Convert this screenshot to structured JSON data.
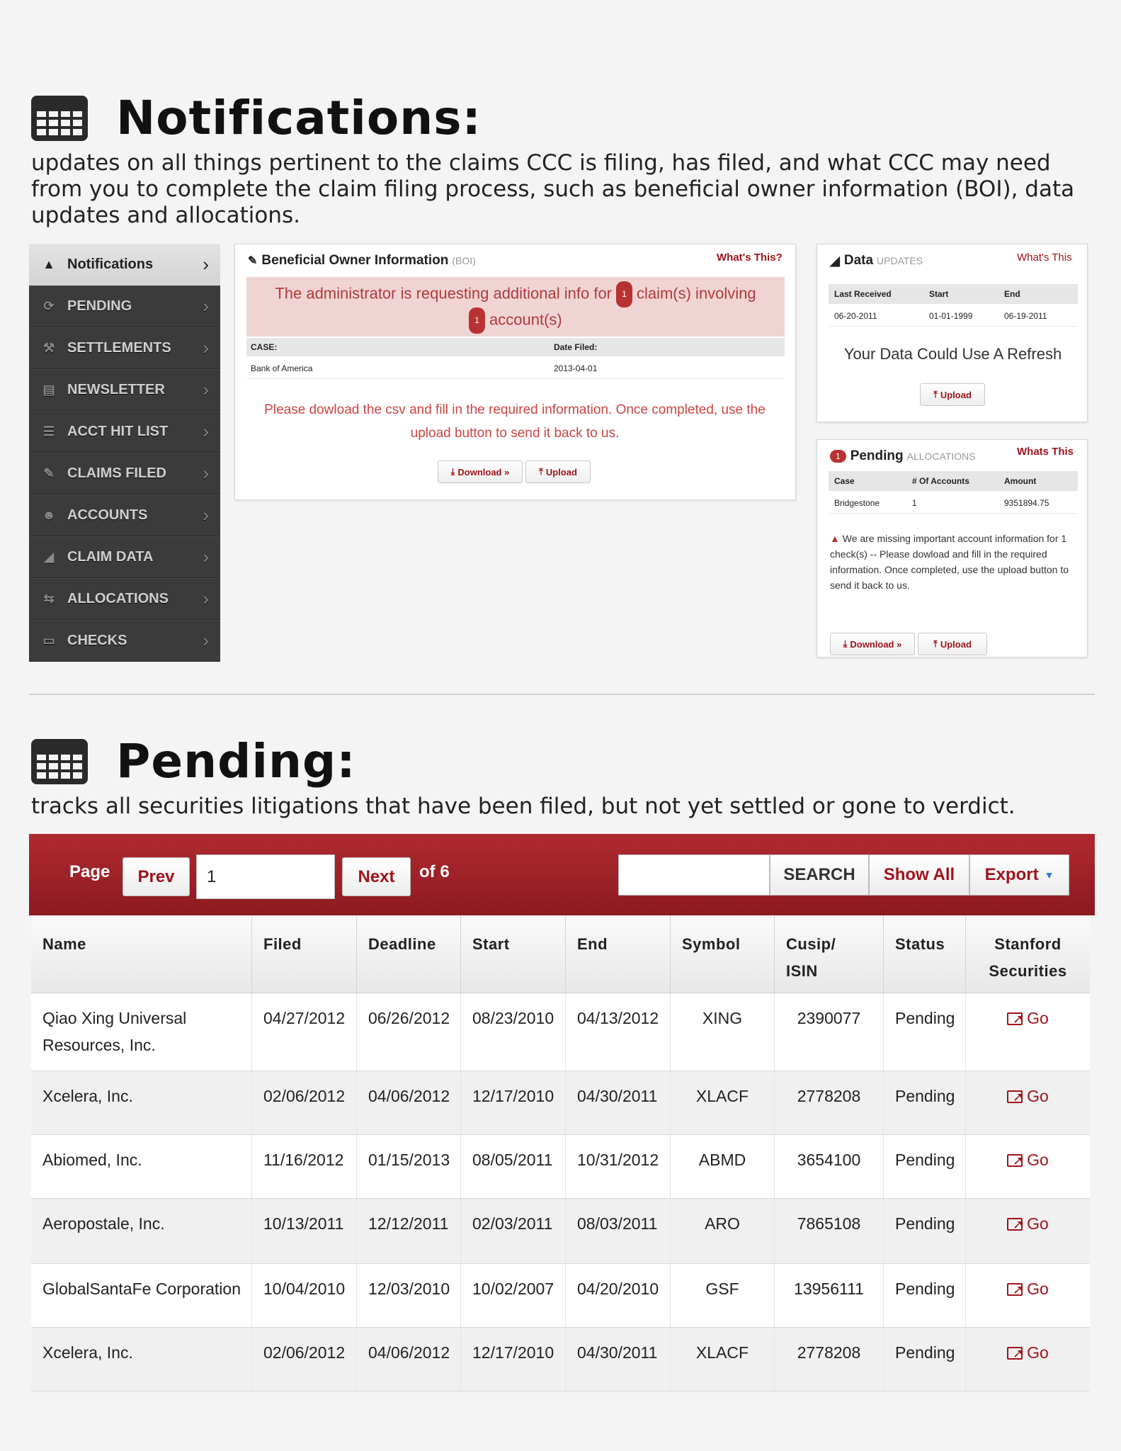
{
  "notifications_section": {
    "title": "Notifications:",
    "description": "updates on all things pertinent to the claims CCC is filing, has filed, and what CCC may need from you to complete the claim filing process, such as beneficial owner information (BOI), data updates and allocations."
  },
  "sidebar": {
    "items": [
      {
        "label": "Notifications",
        "icon": "warning-icon"
      },
      {
        "label": "PENDING",
        "icon": "refresh-icon"
      },
      {
        "label": "SETTLEMENTS",
        "icon": "gavel-icon"
      },
      {
        "label": "NEWSLETTER",
        "icon": "newspaper-icon"
      },
      {
        "label": "ACCT HIT LIST",
        "icon": "list-icon"
      },
      {
        "label": "CLAIMS FILED",
        "icon": "ticket-icon"
      },
      {
        "label": "ACCOUNTS",
        "icon": "users-icon"
      },
      {
        "label": "CLAIM DATA",
        "icon": "chart-icon"
      },
      {
        "label": "ALLOCATIONS",
        "icon": "transfer-icon"
      },
      {
        "label": "CHECKS",
        "icon": "card-icon"
      }
    ]
  },
  "boi_card": {
    "title": "Beneficial Owner Information",
    "title_suffix": "(BOI)",
    "whats_this": "What's This?",
    "alert_part1": "The administrator is requesting additional info for",
    "alert_claims_count": "1",
    "alert_part2": "claim(s) involving",
    "alert_accounts_count": "1",
    "alert_part3": "account(s)",
    "columns": [
      "CASE:",
      "Date Filed:"
    ],
    "rows": [
      [
        "Bank of America",
        "2013-04-01"
      ]
    ],
    "message": "Please dowload the csv and fill in the required information. Once completed, use the upload button to send it back to us.",
    "download_label": "Download »",
    "upload_label": "Upload"
  },
  "data_card": {
    "title": "Data",
    "title_suffix": "UPDATES",
    "whats_this": "What's This",
    "columns": [
      "Last Received",
      "Start",
      "End"
    ],
    "rows": [
      [
        "06-20-2011",
        "01-01-1999",
        "06-19-2011"
      ]
    ],
    "message": "Your Data Could Use A Refresh",
    "upload_label": "Upload"
  },
  "pending_card": {
    "badge": "1",
    "title": "Pending",
    "title_suffix": "ALLOCATIONS",
    "whats_this": "Whats This",
    "columns": [
      "Case",
      "# Of Accounts",
      "Amount"
    ],
    "rows": [
      [
        "Bridgestone",
        "1",
        "9351894.75"
      ]
    ],
    "warning": "We are missing important account information for 1 check(s) -- Please dowload and fill in the required information. Once completed, use the upload button to send it back to us.",
    "download_label": "Download »",
    "upload_label": "Upload"
  },
  "pending_section": {
    "title": "Pending:",
    "description": "tracks all securities litigations that have been filed, but not yet settled or gone to verdict."
  },
  "pager": {
    "page_label": "Page",
    "prev_label": "Prev",
    "page_value": "1",
    "next_label": "Next",
    "of_label": "of 6",
    "search_value": "",
    "search_label": "SEARCH",
    "show_all_label": "Show All",
    "export_label": "Export"
  },
  "pending_table": {
    "columns": [
      {
        "line1": "Name",
        "line2": ""
      },
      {
        "line1": "Filed",
        "line2": ""
      },
      {
        "line1": "Deadline",
        "line2": ""
      },
      {
        "line1": "Start",
        "line2": ""
      },
      {
        "line1": "End",
        "line2": ""
      },
      {
        "line1": "Symbol",
        "line2": ""
      },
      {
        "line1": "Cusip/",
        "line2": "ISIN"
      },
      {
        "line1": "Status",
        "line2": ""
      },
      {
        "line1": "Stanford",
        "line2": "Securities"
      }
    ],
    "go_label": "Go",
    "rows": [
      {
        "name1": "Qiao Xing Universal",
        "name2": "Resources, Inc.",
        "filed": "04/27/2012",
        "deadline": "06/26/2012",
        "start": "08/23/2010",
        "end": "04/13/2012",
        "symbol": "XING",
        "cusip": "2390077",
        "status": "Pending"
      },
      {
        "name1": "Xcelera, Inc.",
        "name2": "",
        "filed": "02/06/2012",
        "deadline": "04/06/2012",
        "start": "12/17/2010",
        "end": "04/30/2011",
        "symbol": "XLACF",
        "cusip": "2778208",
        "status": "Pending"
      },
      {
        "name1": "Abiomed, Inc.",
        "name2": "",
        "filed": "11/16/2012",
        "deadline": "01/15/2013",
        "start": "08/05/2011",
        "end": "10/31/2012",
        "symbol": "ABMD",
        "cusip": "3654100",
        "status": "Pending"
      },
      {
        "name1": "Aeropostale, Inc.",
        "name2": "",
        "filed": "10/13/2011",
        "deadline": "12/12/2011",
        "start": "02/03/2011",
        "end": "08/03/2011",
        "symbol": "ARO",
        "cusip": "7865108",
        "status": "Pending"
      },
      {
        "name1": "GlobalSantaFe Corporation",
        "name2": "",
        "filed": "10/04/2010",
        "deadline": "12/03/2010",
        "start": "10/02/2007",
        "end": "04/20/2010",
        "symbol": "GSF",
        "cusip": "13956111",
        "status": "Pending"
      },
      {
        "name1": "Xcelera, Inc.",
        "name2": "",
        "filed": "02/06/2012",
        "deadline": "04/06/2012",
        "start": "12/17/2010",
        "end": "04/30/2011",
        "symbol": "XLACF",
        "cusip": "2778208",
        "status": "Pending"
      }
    ]
  },
  "colors": {
    "accent_red": "#a0141b",
    "bar_red": "#9b2027",
    "sidebar_dark": "#3b3b3b",
    "alert_bg": "#f0d4d4"
  }
}
